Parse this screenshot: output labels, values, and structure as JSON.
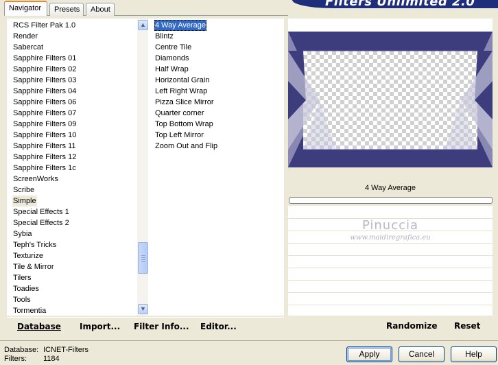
{
  "tabs": [
    "Navigator",
    "Presets",
    "About"
  ],
  "banner_title": "Filters Unlimited 2.0",
  "categories": [
    "RCS Filter Pak 1.0",
    "Render",
    "Sabercat",
    "Sapphire Filters 01",
    "Sapphire Filters 02",
    "Sapphire Filters 03",
    "Sapphire Filters 04",
    "Sapphire Filters 06",
    "Sapphire Filters 07",
    "Sapphire Filters 09",
    "Sapphire Filters 10",
    "Sapphire Filters 11",
    "Sapphire Filters 12",
    "Sapphire Filters 1c",
    "ScreenWorks",
    "Scribe",
    "Simple",
    "Special Effects 1",
    "Special Effects 2",
    "Sybia",
    "Teph's Tricks",
    "Texturize",
    "Tile & Mirror",
    "Tilers",
    "Toadies",
    "Tools",
    "Tormentia"
  ],
  "selected_category": "Simple",
  "filters": [
    "4 Way Average",
    "Blintz",
    "Centre Tile",
    "Diamonds",
    "Half Wrap",
    "Horizontal Grain",
    "Left Right Wrap",
    "Pizza Slice Mirror",
    "Quarter corner",
    "Top Bottom Wrap",
    "Top Left Mirror",
    "Zoom Out and Flip"
  ],
  "selected_filter": "4 Way Average",
  "preview": {
    "filter_name": "4 Way Average",
    "watermark_name": "Pinuccia",
    "watermark_url": "www.maidiregrafica.eu",
    "frame_color": "#3d3d7e",
    "light_color": "#c6c6dc"
  },
  "toolbar": {
    "database": "Database",
    "import": "Import...",
    "filter_info": "Filter Info...",
    "editor": "Editor...",
    "randomize": "Randomize",
    "reset": "Reset"
  },
  "status": {
    "database_label": "Database:",
    "database_value": "ICNET-Filters",
    "filters_label": "Filters:",
    "filters_value": "1184"
  },
  "buttons": {
    "apply": "Apply",
    "cancel": "Cancel",
    "help": "Help"
  }
}
